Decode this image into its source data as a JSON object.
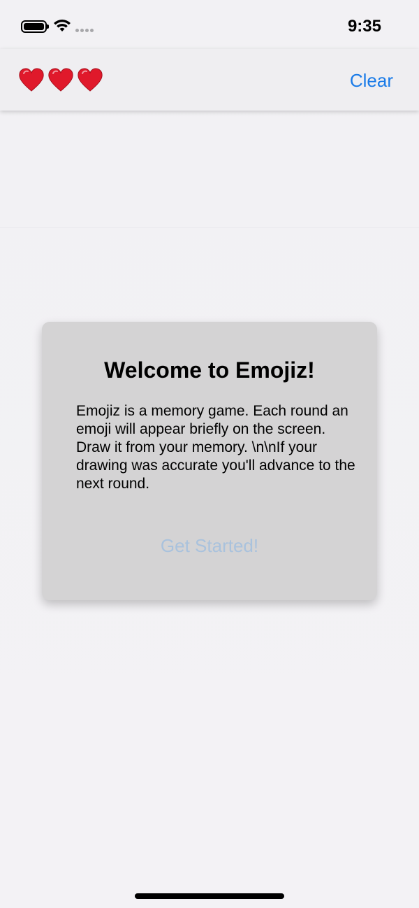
{
  "status_bar": {
    "time": "9:35",
    "battery_icon": "battery-full-icon",
    "wifi_icon": "wifi-icon",
    "signal_icon": "cellular-no-signal-icon"
  },
  "nav_bar": {
    "lives": 3,
    "heart_icon": "red-heart-icon",
    "heart_color": "#e0192b",
    "clear_label": "Clear",
    "accent_color": "#1a7be8"
  },
  "welcome_modal": {
    "title": "Welcome to Emojiz!",
    "body": "Emojiz is a memory game. Each round an emoji will appear briefly on the screen. Draw it from your memory. \\n\\nIf your drawing was accurate you'll advance to the next round.",
    "get_started_label": "Get Started!",
    "get_started_color": "#a9c2dd",
    "card_color": "#d4d3d4"
  }
}
